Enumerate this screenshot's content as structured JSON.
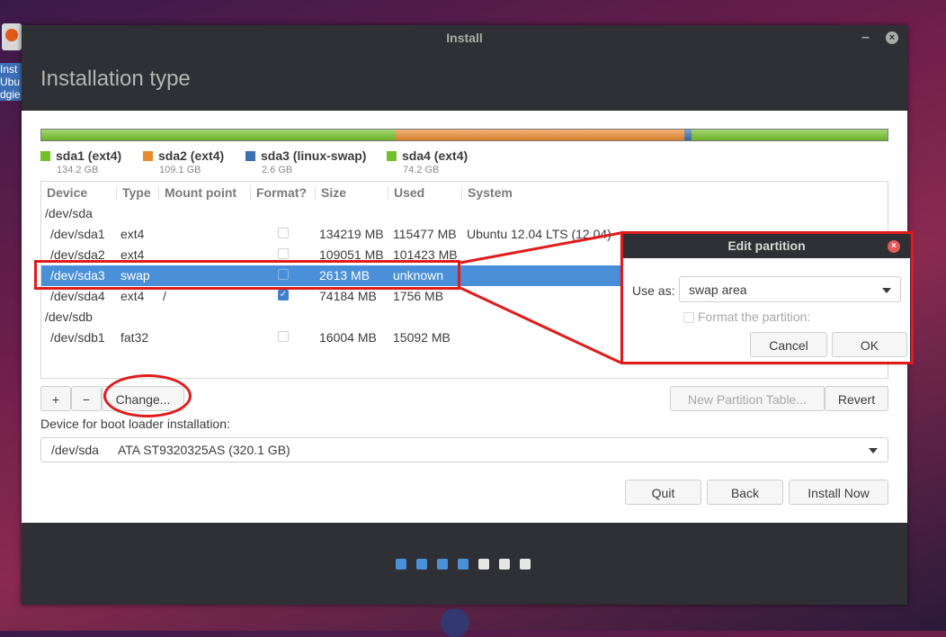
{
  "desktop": {
    "icon_label": "Inst\nUbu\ndgie"
  },
  "window": {
    "title": "Install",
    "minimize_glyph": "–",
    "close_glyph": "×"
  },
  "page_title": "Installation type",
  "partition_bar": {
    "segments": [
      {
        "color": "#73c02a",
        "share": 0.419
      },
      {
        "color": "#e88a2e",
        "share": 0.341
      },
      {
        "color": "#3a6fb0",
        "share": 0.008
      },
      {
        "color": "#73c02a",
        "share": 0.232
      }
    ]
  },
  "legend": [
    {
      "name": "sda1 (ext4)",
      "size": "134.2 GB",
      "color": "#73c02a"
    },
    {
      "name": "sda2 (ext4)",
      "size": "109.1 GB",
      "color": "#e88a2e"
    },
    {
      "name": "sda3 (linux-swap)",
      "size": "2.6 GB",
      "color": "#3a6fb0"
    },
    {
      "name": "sda4 (ext4)",
      "size": "74.2 GB",
      "color": "#73c02a"
    }
  ],
  "table": {
    "headers": [
      "Device",
      "Type",
      "Mount point",
      "Format?",
      "Size",
      "Used",
      "System"
    ],
    "rows": [
      {
        "device": "/dev/sda",
        "type": "",
        "mount": "",
        "format": null,
        "size": "",
        "used": "",
        "system": ""
      },
      {
        "device": "/dev/sda1",
        "type": "ext4",
        "mount": "",
        "format": false,
        "size": "134219 MB",
        "used": "115477 MB",
        "system": "Ubuntu 12.04 LTS (12.04)"
      },
      {
        "device": "/dev/sda2",
        "type": "ext4",
        "mount": "",
        "format": false,
        "size": "109051 MB",
        "used": "101423 MB",
        "system": ""
      },
      {
        "device": "/dev/sda3",
        "type": "swap",
        "mount": "",
        "format": false,
        "size": "2613 MB",
        "used": "unknown",
        "system": "",
        "selected": true
      },
      {
        "device": "/dev/sda4",
        "type": "ext4",
        "mount": "/",
        "format": true,
        "size": "74184 MB",
        "used": "1756 MB",
        "system": ""
      },
      {
        "device": "/dev/sdb",
        "type": "",
        "mount": "",
        "format": null,
        "size": "",
        "used": "",
        "system": ""
      },
      {
        "device": "/dev/sdb1",
        "type": "fat32",
        "mount": "",
        "format": false,
        "size": "16004 MB",
        "used": "15092 MB",
        "system": ""
      }
    ]
  },
  "toolbar": {
    "add": "+",
    "remove": "−",
    "change": "Change...",
    "new_table": "New Partition Table...",
    "revert": "Revert"
  },
  "bootloader": {
    "label": "Device for boot loader installation:",
    "device": "/dev/sda",
    "description": "ATA ST9320325AS (320.1 GB)"
  },
  "actions": {
    "quit": "Quit",
    "back": "Back",
    "install": "Install Now"
  },
  "progress": {
    "total_steps": 7,
    "completed_steps": 4,
    "active_color": "#4a90d9",
    "inactive_color": "#e6e6e6"
  },
  "dialog": {
    "title": "Edit partition",
    "use_as_label": "Use as:",
    "use_as_value": "swap area",
    "format_label": "Format the partition:",
    "cancel": "Cancel",
    "ok": "OK"
  },
  "annotation": {
    "color": "#e01b1b"
  }
}
